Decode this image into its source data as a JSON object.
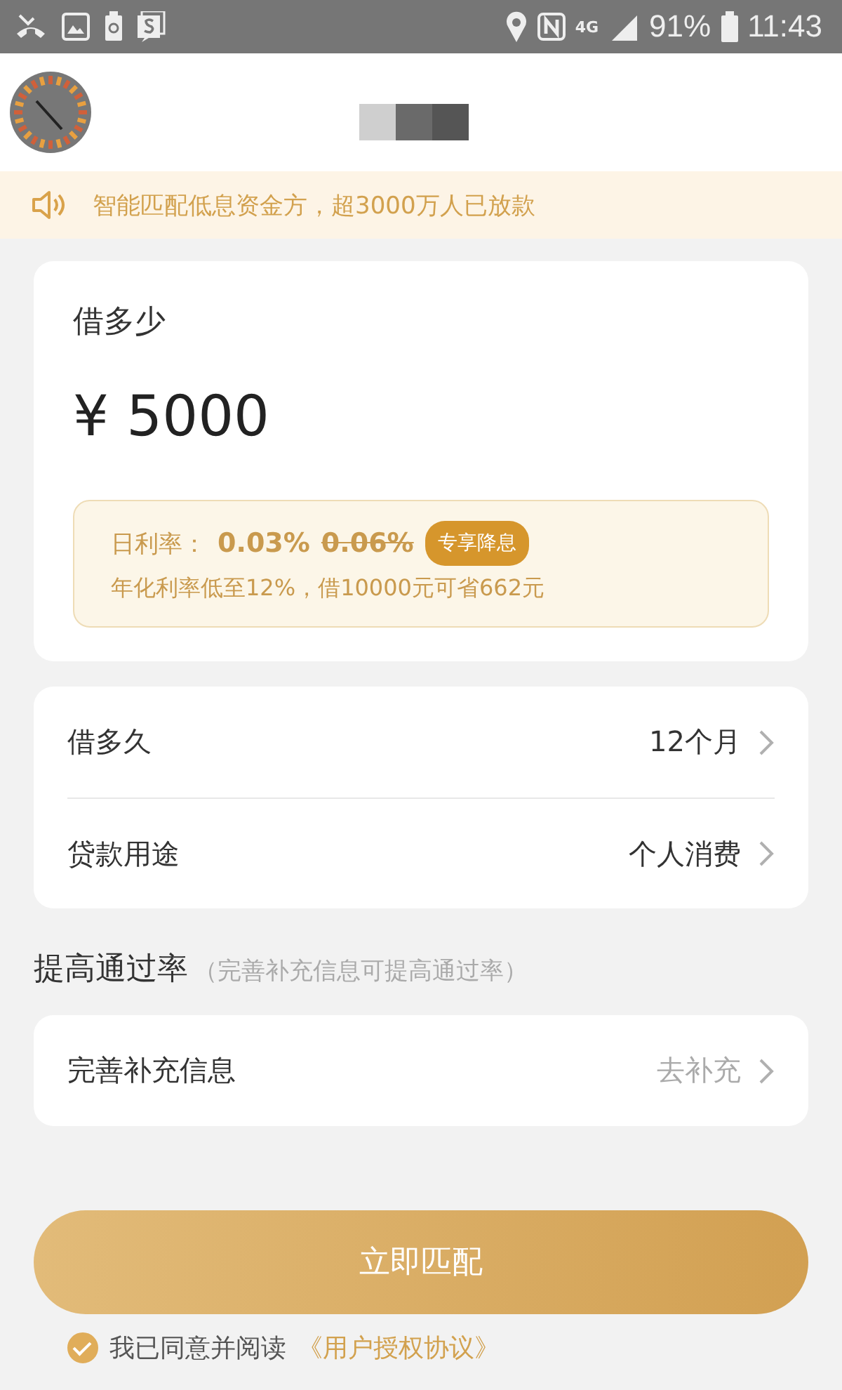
{
  "status_bar": {
    "network": "4G",
    "battery": "91%",
    "time": "11:43"
  },
  "notice": "智能匹配低息资金方，超3000万人已放款",
  "loan": {
    "label": "借多少",
    "amount": "¥ 5000",
    "rate": {
      "label": "日利率：",
      "rate": "0.03%",
      "original_rate": "0.06%",
      "badge": "专享降息",
      "note": "年化利率低至12%，借10000元可省662元"
    }
  },
  "options": [
    {
      "label": "借多久",
      "value": "12个月"
    },
    {
      "label": "贷款用途",
      "value": "个人消费"
    }
  ],
  "section": {
    "title": "提高通过率",
    "hint": "（完善补充信息可提高通过率）"
  },
  "supplement": {
    "label": "完善补充信息",
    "action": "去补充"
  },
  "submit": "立即匹配",
  "agreement": {
    "checked": true,
    "text": "我已同意并阅读",
    "link": "《用户授权协议》"
  }
}
